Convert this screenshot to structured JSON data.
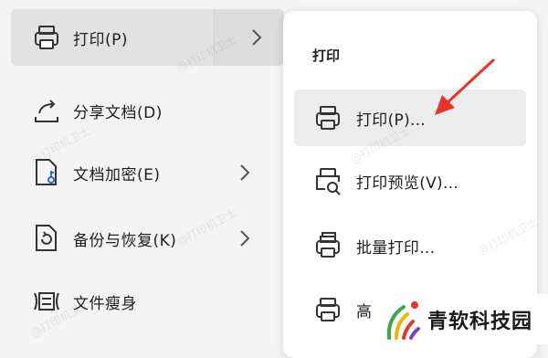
{
  "left_menu": {
    "items": [
      {
        "label": "打印(P)",
        "icon": "printer-icon",
        "has_submenu": true
      },
      {
        "label": "分享文档(D)",
        "icon": "share-icon",
        "has_submenu": false
      },
      {
        "label": "文档加密(E)",
        "icon": "encrypt-document-icon",
        "has_submenu": true
      },
      {
        "label": "备份与恢复(K)",
        "icon": "backup-restore-icon",
        "has_submenu": true
      },
      {
        "label": "文件瘦身",
        "icon": "slim-file-icon",
        "has_submenu": false
      }
    ]
  },
  "submenu": {
    "title": "打印",
    "items": [
      {
        "label": "打印(P)...",
        "icon": "printer-icon"
      },
      {
        "label": "打印预览(V)...",
        "icon": "print-preview-icon"
      },
      {
        "label": "批量打印...",
        "icon": "batch-print-icon"
      },
      {
        "label": "高",
        "icon": "printer-icon"
      }
    ]
  },
  "watermark": {
    "text": "@打印机卫士"
  },
  "brand": {
    "name": "青软科技园"
  },
  "colors": {
    "accent_arrow": "#e8332a",
    "active_bg": "#e2e2e2",
    "hover_bg": "#ececec"
  }
}
